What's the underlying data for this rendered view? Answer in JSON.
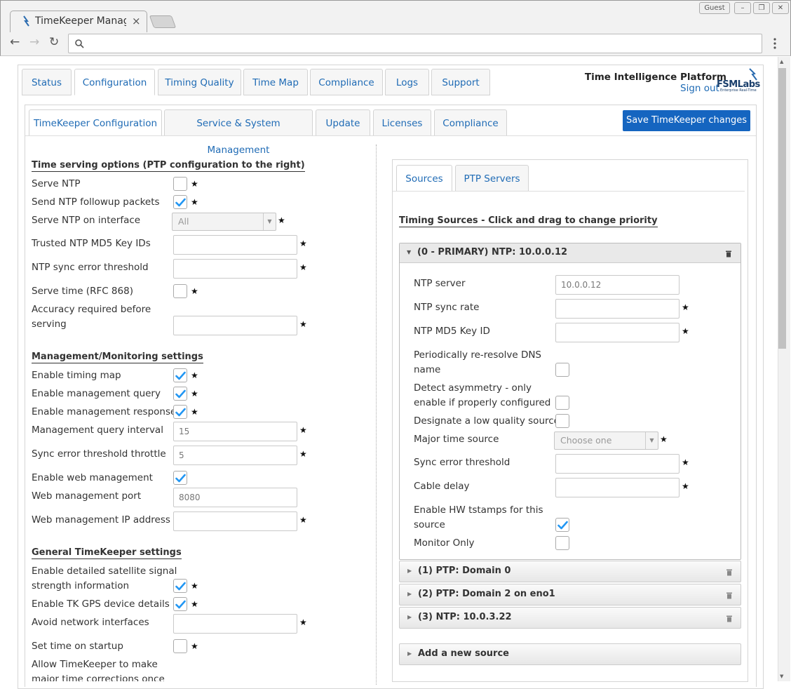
{
  "browser": {
    "tab_title": "TimeKeeper Management",
    "profile": "Guest",
    "window_controls": [
      "–",
      "❐",
      "✕"
    ]
  },
  "top_tabs": [
    "Status",
    "Configuration",
    "Timing Quality",
    "Time Map",
    "Compliance",
    "Logs",
    "Support"
  ],
  "brand": {
    "title": "Time Intelligence Platform",
    "signout": "Sign out",
    "logo": "FSMLabs",
    "logo_sub": "Enterprise Real-Time"
  },
  "sub_tabs": [
    "TimeKeeper Configuration",
    "Service & System Management",
    "Update",
    "Licenses",
    "Compliance"
  ],
  "save_label": "Save TimeKeeper changes",
  "left": {
    "time_serving": {
      "heading": "Time serving options (PTP configuration to the right)",
      "serve_ntp": "Serve NTP",
      "followup": "Send NTP followup packets",
      "interface": "Serve NTP on interface",
      "interface_value": "All",
      "md5": "Trusted NTP MD5 Key IDs",
      "sync_error": "NTP sync error threshold",
      "rfc868": "Serve time (RFC 868)",
      "accuracy_1": "Accuracy required before",
      "accuracy_2": "serving"
    },
    "mgmt": {
      "heading": "Management/Monitoring settings",
      "timing_map": "Enable timing map",
      "query": "Enable management query",
      "response": "Enable management response",
      "interval": "Management query interval",
      "interval_value": "15",
      "throttle": "Sync error threshold throttle",
      "throttle_value": "5",
      "web": "Enable web management",
      "port": "Web management port",
      "port_value": "8080",
      "ip": "Web management IP address"
    },
    "general": {
      "heading": "General TimeKeeper settings",
      "satellite_1": "Enable detailed satellite signal",
      "satellite_2": "strength information",
      "gps": "Enable TK GPS device details",
      "avoid": "Avoid network interfaces",
      "startup": "Set time on startup",
      "allow_1": "Allow TimeKeeper to make",
      "allow_2": "major time corrections once"
    }
  },
  "right": {
    "tabs": [
      "Sources",
      "PTP Servers"
    ],
    "heading": "Timing Sources - Click and drag to change priority",
    "primary": {
      "title": "(0 - PRIMARY) NTP: 10.0.0.12",
      "server": "NTP server",
      "server_value": "10.0.0.12",
      "rate": "NTP sync rate",
      "md5": "NTP MD5 Key ID",
      "dns_1": "Periodically re-resolve DNS",
      "dns_2": "name",
      "asym_1": "Detect asymmetry - only",
      "asym_2": "enable if properly configured",
      "lowq": "Designate a low quality source",
      "major": "Major time source",
      "major_placeholder": "Choose one",
      "sync": "Sync error threshold",
      "cable": "Cable delay",
      "hw_1": "Enable HW tstamps for this",
      "hw_2": "source",
      "monitor": "Monitor Only"
    },
    "sources": [
      "(1) PTP: Domain 0",
      "(2) PTP: Domain 2 on eno1",
      "(3) NTP: 10.0.3.22"
    ],
    "add": "Add a new source"
  },
  "star": "★",
  "arrows": {
    "collapsed": "▶",
    "expanded": "▼",
    "select": "▼"
  }
}
